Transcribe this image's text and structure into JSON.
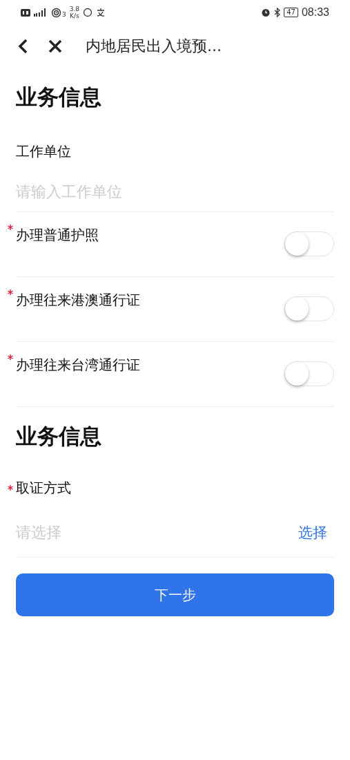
{
  "status_bar": {
    "hotspot_count": "3",
    "net_speed": "3.8",
    "net_unit": "K/s",
    "battery": "47",
    "time": "08:33"
  },
  "nav": {
    "title": "内地居民出入境预..."
  },
  "sections": [
    {
      "title": "业务信息",
      "items": [
        {
          "kind": "text_field",
          "label": "工作单位",
          "placeholder": "请输入工作单位"
        },
        {
          "kind": "toggle",
          "label": "办理普通护照",
          "required": true,
          "on": false
        },
        {
          "kind": "toggle",
          "label": "办理往来港澳通行证",
          "required": true,
          "on": false
        },
        {
          "kind": "toggle",
          "label": "办理往来台湾通行证",
          "required": true,
          "on": false
        }
      ]
    },
    {
      "title": "业务信息",
      "items": [
        {
          "kind": "select",
          "label": "取证方式",
          "required": true,
          "placeholder": "请选择",
          "action": "选择"
        }
      ]
    }
  ],
  "next_button": "下一步"
}
